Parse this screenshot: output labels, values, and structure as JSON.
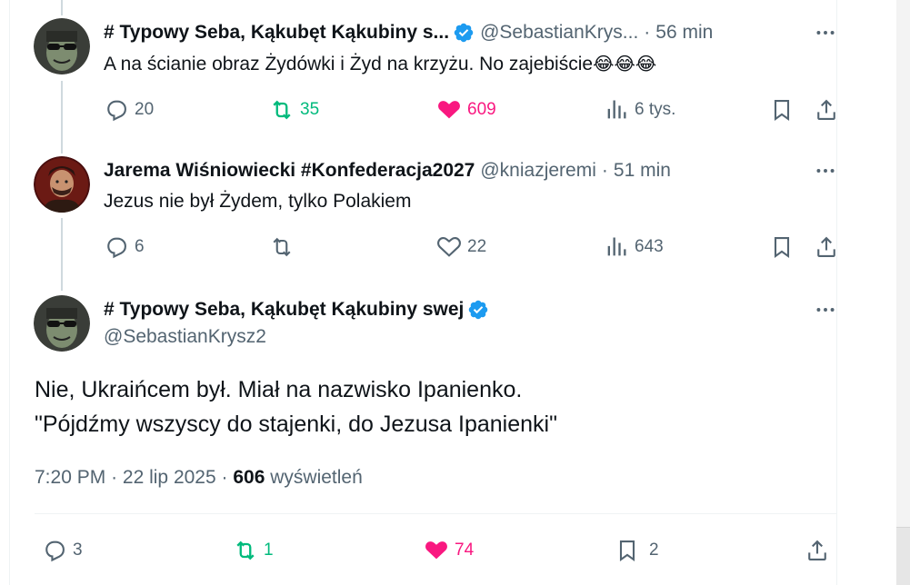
{
  "replies": [
    {
      "display_name": "# Typowy Seba, Kąkubęt Kąkubiny s...",
      "handle": "@SebastianKrys...",
      "time": "56 min",
      "text": "A na ścianie obraz Żydówki i Żyd na krzyżu. No zajebiście",
      "emoji": "😂😂😂",
      "stats": {
        "replies": "20",
        "reposts": "35",
        "likes": "609",
        "views": "6 tys."
      },
      "liked": true,
      "reposted": true
    },
    {
      "display_name": "Jarema Wiśniowiecki #Konfederacja2027",
      "handle": "@kniazjeremi",
      "time": "51 min",
      "text": "Jezus nie był Żydem, tylko Polakiem",
      "stats": {
        "replies": "6",
        "reposts": "",
        "likes": "22",
        "views": "643"
      },
      "liked": false,
      "reposted": false
    }
  ],
  "focus_tweet": {
    "display_name": "# Typowy Seba, Kąkubęt Kąkubiny swej",
    "handle": "@SebastianKrysz2",
    "text_line1": "Nie, Ukraińcem był. Miał na nazwisko Ipanienko.",
    "text_line2": "\"Pójdźmy wszyscy do stajenki, do Jezusa Ipanienki\"",
    "time": "7:20 PM",
    "date": "22 lip 2025",
    "views_count": "606",
    "views_label": "wyświetleń",
    "stats": {
      "replies": "3",
      "reposts": "1",
      "likes": "74",
      "bookmarks": "2"
    }
  },
  "separator": "·",
  "colors": {
    "text": "#0f1419",
    "secondary": "#536471",
    "verified": "#1d9bf0",
    "repost_active": "#00ba7c",
    "like_active": "#f91880",
    "thread_line": "#cfd9de"
  }
}
